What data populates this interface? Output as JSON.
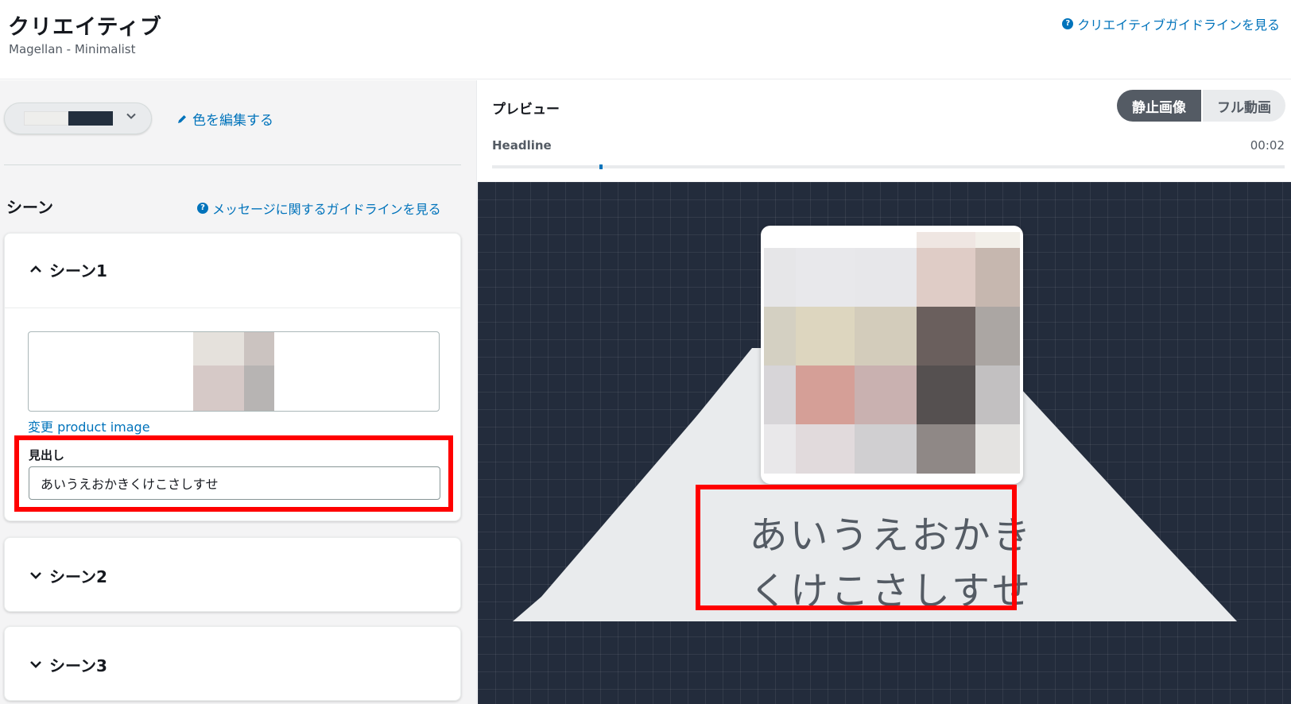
{
  "header": {
    "title": "クリエイティブ",
    "subtitle": "Magellan - Minimalist",
    "guideline_link": "クリエイティブガイドラインを見る"
  },
  "left_panel": {
    "color_select": {
      "swatch_colors": [
        "#eeeeec",
        "#232f3e"
      ]
    },
    "edit_color_link": "色を編集する",
    "scenes_title": "シーン",
    "scenes_guideline_link": "メッセージに関するガイドラインを見る",
    "scenes": [
      {
        "title": "シーン1",
        "expanded": true,
        "change_image_link": "変更 product image",
        "headline_label": "見出し",
        "headline_value": "あいうえおかきくけこさしすせ"
      },
      {
        "title": "シーン2",
        "expanded": false
      },
      {
        "title": "シーン3",
        "expanded": false
      }
    ]
  },
  "preview": {
    "title": "プレビュー",
    "toggle": {
      "still": "静止画像",
      "video": "フル動画",
      "active": "still"
    },
    "timeline_label": "Headline",
    "timeline_time": "00:02",
    "timeline_progress": 0.135,
    "headline_line1": "あいうえおかき",
    "headline_line2": "くけこさしすせ"
  },
  "colors": {
    "link": "#0073bb",
    "highlight": "#ff0000",
    "stage_background": "#232c3c",
    "toggle_active": "#545b64"
  }
}
